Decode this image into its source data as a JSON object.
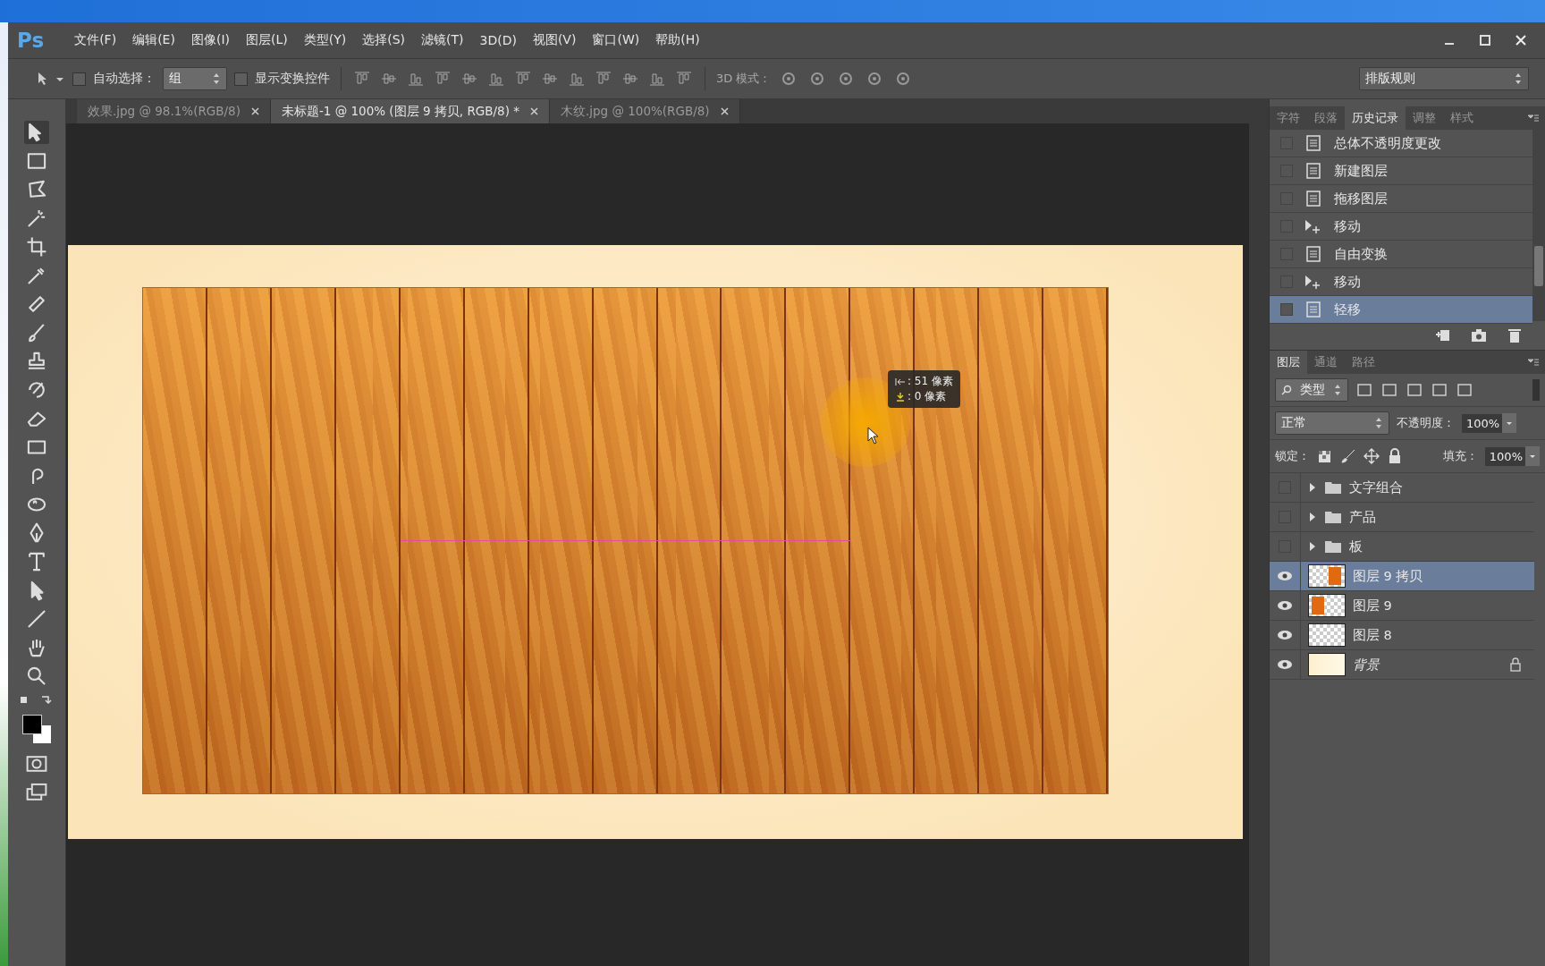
{
  "app_logo": "Ps",
  "menu": [
    "文件(F)",
    "编辑(E)",
    "图像(I)",
    "图层(L)",
    "类型(Y)",
    "选择(S)",
    "滤镜(T)",
    "3D(D)",
    "视图(V)",
    "窗口(W)",
    "帮助(H)"
  ],
  "options_bar": {
    "auto_select": {
      "label": "自动选择：",
      "checked": false
    },
    "auto_select_target": "组",
    "show_transform": {
      "label": "显示变换控件",
      "checked": false
    },
    "mode_label": "3D 模式：",
    "workspace": "排版规则"
  },
  "doc_tabs": [
    {
      "label": "效果.jpg @ 98.1%(RGB/8)",
      "selected": false
    },
    {
      "label": "未标题-1 @ 100% (图层 9 拷贝, RGB/8) *",
      "selected": true
    },
    {
      "label": "木纹.jpg @ 100%(RGB/8)",
      "selected": false
    }
  ],
  "tooltip": {
    "lines": [
      {
        "kind": "horizontal",
        "text": ": 51 像素"
      },
      {
        "kind": "vertical",
        "text": ":  0 像素"
      }
    ]
  },
  "history_panel": {
    "tabs": [
      {
        "label": "字符",
        "selected": false
      },
      {
        "label": "段落",
        "selected": false
      },
      {
        "label": "历史记录",
        "selected": true
      },
      {
        "label": "调整",
        "selected": false
      },
      {
        "label": "样式",
        "selected": false
      }
    ],
    "items": [
      {
        "label": "总体不透明度更改",
        "kind": "document",
        "selected": false
      },
      {
        "label": "新建图层",
        "kind": "document",
        "selected": false
      },
      {
        "label": "拖移图层",
        "kind": "document",
        "selected": false
      },
      {
        "label": "移动",
        "kind": "move",
        "selected": false
      },
      {
        "label": "自由变换",
        "kind": "document",
        "selected": false
      },
      {
        "label": "移动",
        "kind": "move",
        "selected": false
      },
      {
        "label": "轻移",
        "kind": "document",
        "selected": true
      }
    ]
  },
  "layers_panel": {
    "tabs": [
      {
        "label": "图层",
        "selected": true
      },
      {
        "label": "通道",
        "selected": false
      },
      {
        "label": "路径",
        "selected": false
      }
    ],
    "filter": "类型",
    "blend_mode": "正常",
    "opacity_label": "不透明度：",
    "opacity": "100%",
    "lock_label": "锁定：",
    "fill_label": "填充：",
    "fill": "100%",
    "layers": [
      {
        "name": "文字组合",
        "kind": "group",
        "visible": false,
        "selected": false
      },
      {
        "name": "产品",
        "kind": "group",
        "visible": false,
        "selected": false
      },
      {
        "name": "板",
        "kind": "group",
        "visible": false,
        "selected": false
      },
      {
        "name": "图层 9 拷贝",
        "kind": "layer",
        "block_on_right": true,
        "visible": true,
        "selected": true
      },
      {
        "name": "图层 9",
        "kind": "layer",
        "block_on_right": false,
        "visible": true,
        "selected": false
      },
      {
        "name": "图层 8",
        "kind": "blank",
        "visible": true,
        "selected": false
      },
      {
        "name": "背景",
        "kind": "background",
        "visible": true,
        "selected": false,
        "locked": true
      }
    ]
  }
}
